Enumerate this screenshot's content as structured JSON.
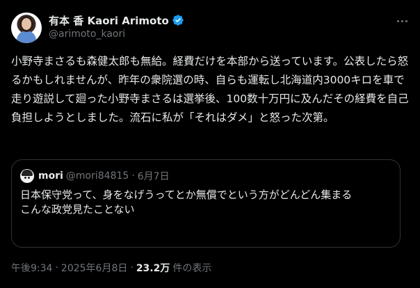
{
  "author": {
    "display_name": "有本 香 Kaori Arimoto",
    "handle": "@arimoto_kaori",
    "verified": true
  },
  "tweet": {
    "text": "小野寺まさるも森健太郎も無給。経費だけを本部から送っています。公表したら怒るかもしれませんが、昨年の衆院選の時、自らも運転し北海道内3000キロを車で走り遊説して廻った小野寺まさるは選挙後、100数十万円に及んだその経費を自己負担しようとしました。流石に私が「それはダメ」と怒った次第。"
  },
  "quote": {
    "name": "mori",
    "handle": "@mori84815",
    "dot": "·",
    "date": "6月7日",
    "text": "日本保守党って、身をなげうってとか無償でという方がどんどん集まる\nこんな政党見たことない"
  },
  "meta": {
    "time": "午後9:34",
    "sep1": "·",
    "date": "2025年6月8日",
    "sep2": "·",
    "views_count": "23.2万",
    "views_label": "件の表示"
  },
  "colors": {
    "background": "#000000",
    "text": "#e7e9ea",
    "secondary": "#71767b",
    "verified": "#1d9bf0",
    "border": "#2f3336"
  }
}
